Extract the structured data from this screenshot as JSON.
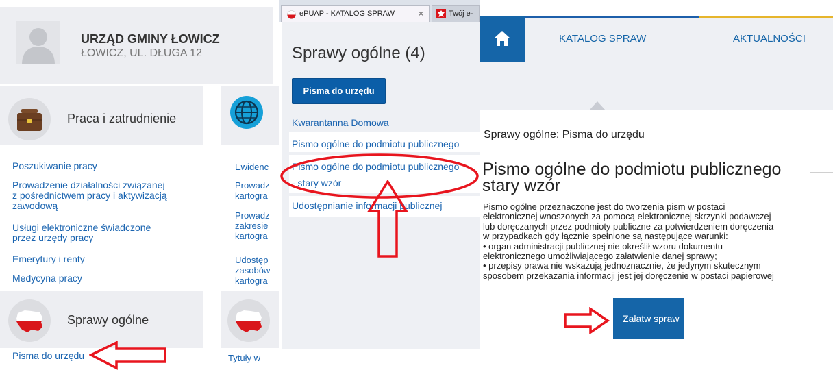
{
  "panel1": {
    "office_name": "URZĄD GMINY ŁOWICZ",
    "office_address": "ŁOWICZ, UL. DŁUGA 12",
    "category_work": {
      "title": "Praca i zatrudnienie",
      "icon": "briefcase-icon",
      "links": [
        "Poszukiwanie pracy",
        "Prowadzenie działalności związanej\nz pośrednictwem pracy i aktywizacją\nzawodową",
        "Usługi elektroniczne świadczone\nprzez urzędy pracy",
        "Emerytury i renty",
        "Medycyna pracy"
      ]
    },
    "category_geo": {
      "icon": "globe-icon",
      "links": [
        "Ewidenc",
        "Prowadz\nkartogra",
        "Prowadz\nzakresie\nkartogra",
        "Udostęp\nzasobów\nkartogra"
      ]
    },
    "category_general": {
      "title": "Sprawy ogólne",
      "icon": "poland-map-icon",
      "link": "Pisma do urzędu"
    },
    "category_titles": {
      "icon": "poland-map-icon",
      "link": "Tytuły w"
    }
  },
  "panel2": {
    "tabs": [
      {
        "label": "ePUAP - KATALOG SPRAW",
        "close": "×",
        "icon": "poland-flag-icon"
      },
      {
        "label": "Twój e-",
        "icon": "emblem-icon"
      }
    ],
    "title": "Sprawy ogólne (4)",
    "button_label": "Pisma do urzędu",
    "items": [
      "Kwarantanna Domowa",
      "Pismo ogólne do podmiotu publicznego",
      "Pismo ogólne do podmiotu publicznego",
      "- stary wzór",
      "Udostępnianie informacji publicznej"
    ]
  },
  "panel3": {
    "home_icon": "home-icon",
    "nav": [
      "KATALOG SPRAW",
      "AKTUALNOŚCI"
    ],
    "breadcrumb": "Sprawy ogólne: Pisma do urzędu",
    "heading_line1": "Pismo ogólne do podmiotu publicznego",
    "heading_line2": "stary wzór",
    "description": "Pismo ogólne przeznaczone jest do tworzenia pism w postaci\nelektronicznej wnoszonych za pomocą elektronicznej skrzynki podawczej\nlub doręczanych przez podmioty publiczne za potwierdzeniem doręczenia\nw przypadkach gdy łącznie spełnione są następujące warunki:\n• organ administracji publicznej nie określił wzoru dokumentu\nelektronicznego umożliwiającego załatwienie danej sprawy;\n• przepisy prawa nie wskazują jednoznacznie, że jedynym skutecznym\nsposobem przekazania informacji jest jej doręczenie w postaci papierowej",
    "button_label": "Załatw spraw"
  },
  "colors": {
    "accent_blue": "#1565a8",
    "annotation_red": "#e8151e",
    "top_line_blue": "#1d5faa",
    "top_line_yellow": "#e6b52c"
  }
}
